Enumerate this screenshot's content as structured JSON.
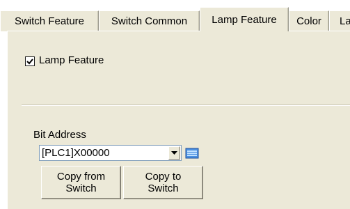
{
  "tabs": [
    {
      "label": "Switch Feature",
      "active": false
    },
    {
      "label": "Switch Common",
      "active": false
    },
    {
      "label": "Lamp Feature",
      "active": true
    },
    {
      "label": "Color",
      "active": false
    },
    {
      "label": "La",
      "active": false
    }
  ],
  "lamp_feature": {
    "label": "Lamp Feature",
    "checked": true
  },
  "bit_address": {
    "label": "Bit Address",
    "value": "[PLC1]X00000",
    "copy_from_line1": "Copy from",
    "copy_from_line2": "Switch",
    "copy_to_line1": "Copy to",
    "copy_to_line2": "Switch"
  },
  "colors": {
    "face": "#ece9d8",
    "border_dark": "#716f64"
  }
}
